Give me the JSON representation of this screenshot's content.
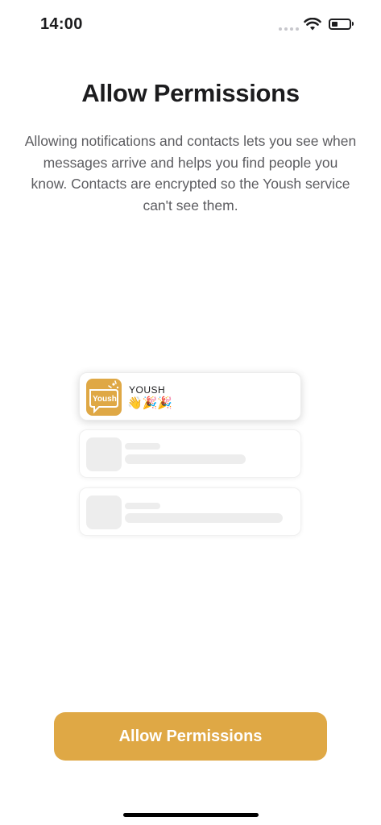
{
  "status_bar": {
    "time": "14:00",
    "signal_icon": "signal-dots-icon",
    "wifi_icon": "wifi-icon",
    "battery_icon": "battery-icon"
  },
  "title": "Allow Permissions",
  "description": "Allowing notifications and contacts lets you see when messages arrive and helps you find people you know. Contacts are encrypted so the Yoush service can't see them.",
  "notification": {
    "app_icon": "yoush-app-icon",
    "app_icon_text": "Yoush",
    "app_name": "YOUSH",
    "message": "👋🎉🎉"
  },
  "primary_button": {
    "label": "Allow Permissions"
  },
  "colors": {
    "accent": "#dfa845",
    "placeholder": "#ededed"
  }
}
